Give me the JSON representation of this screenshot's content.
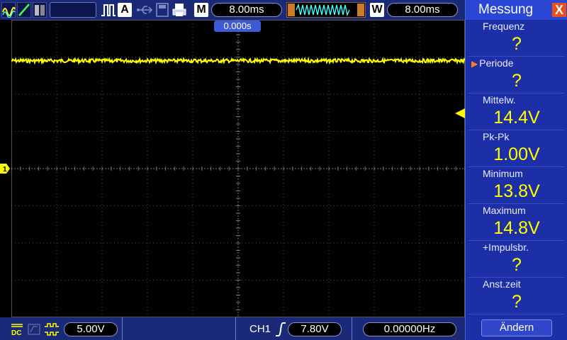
{
  "toolbar": {
    "run_mode_letter": "A",
    "main_letter": "M",
    "main_timebase": "8.00ms",
    "window_letter": "W",
    "window_timebase": "8.00ms"
  },
  "waveform": {
    "time_offset": "0.000s",
    "channel_marker": "1",
    "trace_color": "#ffff00",
    "trace_level_divisions_above_center": 2.9
  },
  "statusbar": {
    "ch1_scale": "5.00V",
    "trigger_source": "CH1",
    "trigger_level": "7.80V",
    "frequency_counter": "0.00000Hz"
  },
  "panel": {
    "title": "Messung",
    "close_symbol": "X",
    "measurements": [
      {
        "label": "Frequenz",
        "value": "?",
        "selected": false
      },
      {
        "label": "Periode",
        "value": "?",
        "selected": true
      },
      {
        "label": "Mittelw.",
        "value": "14.4V",
        "selected": false
      },
      {
        "label": "Pk-Pk",
        "value": "1.00V",
        "selected": false
      },
      {
        "label": "Minimum",
        "value": "13.8V",
        "selected": false
      },
      {
        "label": "Maximum",
        "value": "14.8V",
        "selected": false
      },
      {
        "label": "+Impulsbr.",
        "value": "?",
        "selected": false
      },
      {
        "label": "Anst.zeit",
        "value": "?",
        "selected": false
      }
    ],
    "change_button": "Ändern"
  },
  "colors": {
    "panel_bg": "#1c2fa6",
    "toolbar_bg": "#1b2a78",
    "value_yellow": "#ffff00",
    "close_orange": "#e8501c"
  }
}
